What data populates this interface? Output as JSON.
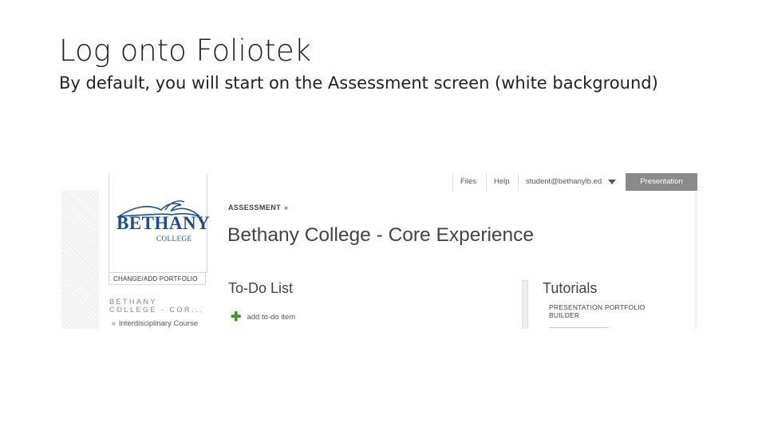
{
  "slide": {
    "title": "Log onto Foliotek",
    "subtitle": "By default, you will start on the Assessment screen (white background)"
  },
  "screenshot": {
    "topbar": {
      "files": "Files",
      "help": "Help",
      "user": "student@bethanylb.ed",
      "presentation": "Presentation"
    },
    "sidebar": {
      "logo_word": "BETHANY",
      "logo_sub": "COLLEGE",
      "change_portfolio": "CHANGE/ADD PORTFOLIO",
      "org_name": "BETHANY COLLEGE - COR...",
      "course_item": "Interdisciplinary Course"
    },
    "main": {
      "breadcrumb": "ASSESSMENT",
      "breadcrumb_chevron": "»",
      "heading": "Bethany College - Core Experience",
      "todo": {
        "title": "To-Do List",
        "add_label": "add to-do item"
      },
      "tutorials": {
        "title": "Tutorials",
        "item": "PRESENTATION PORTFOLIO BUILDER"
      }
    },
    "colors": {
      "brand_blue": "#1f4e8c",
      "add_green": "#3a9a2a",
      "presentation_bg": "#8a8a8a"
    },
    "icons": [
      "bethany-bird-logo-icon",
      "chevron-right-icon",
      "caret-down-icon",
      "plus-icon"
    ]
  }
}
